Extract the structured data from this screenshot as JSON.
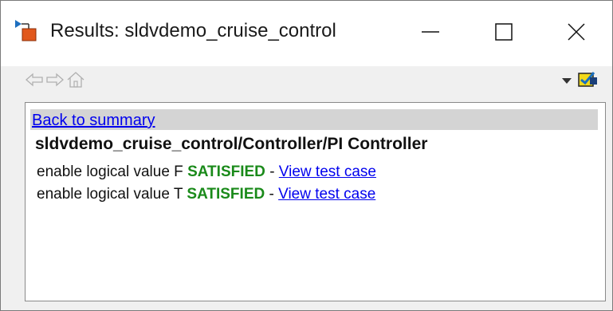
{
  "window": {
    "title": "Results: sldvdemo_cruise_control",
    "icon": "sldv-results-app-icon",
    "controls": [
      "minimize-icon",
      "maximize-icon",
      "close-icon"
    ]
  },
  "toolbar": {
    "icons": [
      "back-arrow-icon",
      "forward-arrow-icon",
      "home-icon",
      "dropdown-arrow-icon",
      "highlight-model-icon"
    ]
  },
  "results": {
    "back_link": "Back to summary",
    "path": "sldvdemo_cruise_control/Controller/PI Controller",
    "rows": [
      {
        "label": "enable logical value F",
        "status": "SATISFIED",
        "sep": "-",
        "link": "View test case"
      },
      {
        "label": "enable logical value T",
        "status": "SATISFIED",
        "sep": "-",
        "link": "View test case"
      }
    ]
  },
  "colors": {
    "status_satisfied": "#1a8a1a",
    "link": "#0000ee",
    "back_row_bg": "#d4d4d4"
  }
}
